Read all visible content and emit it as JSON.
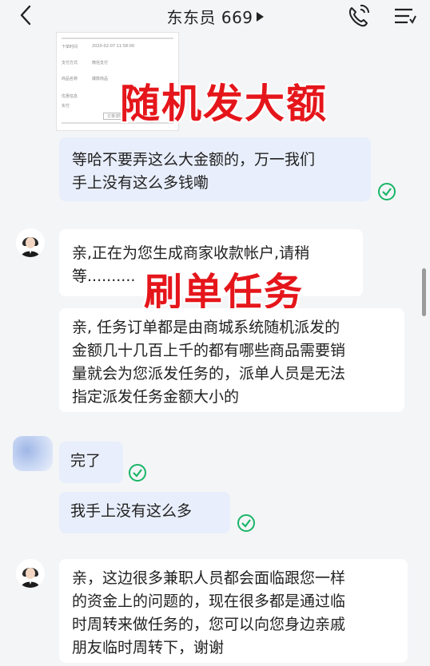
{
  "header": {
    "title": "东东员 669"
  },
  "thumbnail": {
    "rows": [
      "下单时间",
      "支付方式",
      "商品名称",
      "优惠信息",
      "实付"
    ],
    "date_text": "2020-02-07 11:58:00",
    "pay_text": "微信支付",
    "goods_text": "爆款商品",
    "button_text": "订单详情"
  },
  "overlays": {
    "random_big_amount": "随机发大额",
    "brushing_task": "刷单任务"
  },
  "messages": {
    "m1": [
      "等哈不要弄这么大金额的，万一我们",
      "手上没有这么多钱嘞"
    ],
    "m2": [
      "亲,正在为您生成商家收款帐户,请稍",
      "等.........."
    ],
    "m3": [
      "亲, 任务订单都是由商城系统随机派发的",
      "金额几十几百上千的都有哪些商品需要销",
      "量就会为您派发任务的，派单人员是无法",
      "指定派发任务金额大小的"
    ],
    "m4": [
      "完了"
    ],
    "m5": [
      "我手上没有这么多"
    ],
    "m6": [
      "亲，这边很多兼职人员都会面临跟您一样",
      "的资金上的问题的，现在很多都是通过临",
      "时周转来做任务的，您可以向您身边亲戚",
      "朋友临时周转下，谢谢"
    ]
  },
  "colors": {
    "accent_green": "#18b566",
    "overlay_red": "#e5161b",
    "my_bubble": "#e8eefb"
  },
  "icons": {
    "back": "chevron-left-icon",
    "call": "phone-call-icon",
    "menu": "menu-icon",
    "read": "check-circle-icon"
  }
}
